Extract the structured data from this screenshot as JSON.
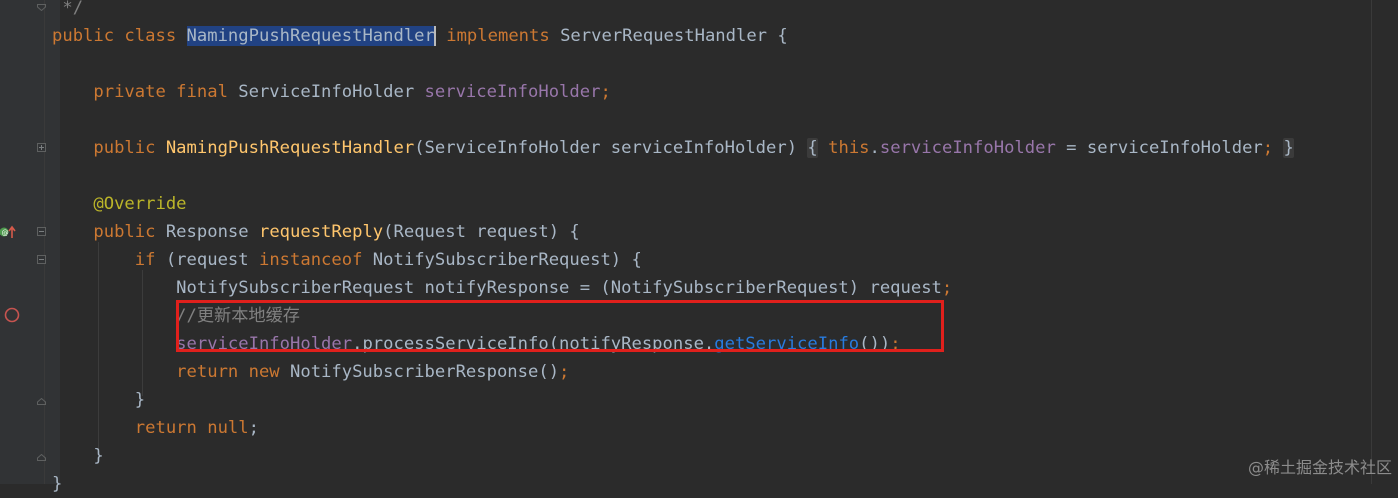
{
  "editor": {
    "lines": [
      {
        "id": "l0",
        "tokens": [
          {
            "c": "cmt",
            "t": " */"
          }
        ]
      },
      {
        "id": "l1",
        "tokens": [
          {
            "c": "kw",
            "t": "public class "
          },
          {
            "c": "sel",
            "t": "NamingPushRequestHandler"
          },
          {
            "c": "caret",
            "t": ""
          },
          {
            "c": "kw",
            "t": " implements "
          },
          {
            "c": "txt",
            "t": "ServerRequestHandler {"
          }
        ]
      },
      {
        "id": "l2",
        "tokens": []
      },
      {
        "id": "l3",
        "tokens": [
          {
            "c": "kw",
            "t": "    private final "
          },
          {
            "c": "txt",
            "t": "ServiceInfoHolder "
          },
          {
            "c": "fld",
            "t": "serviceInfoHolder"
          },
          {
            "c": "kw",
            "t": ";"
          }
        ]
      },
      {
        "id": "l4",
        "tokens": []
      },
      {
        "id": "l5",
        "tokens": [
          {
            "c": "kw",
            "t": "    public "
          },
          {
            "c": "mth",
            "t": "NamingPushRequestHandler"
          },
          {
            "c": "txt",
            "t": "(ServiceInfoHolder serviceInfoHolder) "
          },
          {
            "c": "brace-hl",
            "t": "{"
          },
          {
            "c": "txt",
            "t": " "
          },
          {
            "c": "kw",
            "t": "this"
          },
          {
            "c": "txt",
            "t": "."
          },
          {
            "c": "fld",
            "t": "serviceInfoHolder"
          },
          {
            "c": "txt",
            "t": " = serviceInfoHolder"
          },
          {
            "c": "kw",
            "t": "; "
          },
          {
            "c": "brace-hl",
            "t": "}"
          }
        ]
      },
      {
        "id": "l6",
        "tokens": []
      },
      {
        "id": "l7",
        "tokens": [
          {
            "c": "ann",
            "t": "    @Override"
          }
        ]
      },
      {
        "id": "l8",
        "tokens": [
          {
            "c": "kw",
            "t": "    public "
          },
          {
            "c": "txt",
            "t": "Response "
          },
          {
            "c": "mth",
            "t": "requestReply"
          },
          {
            "c": "txt",
            "t": "(Request request) {"
          }
        ]
      },
      {
        "id": "l9",
        "tokens": [
          {
            "c": "kw",
            "t": "        if "
          },
          {
            "c": "txt",
            "t": "(request "
          },
          {
            "c": "kw",
            "t": "instanceof "
          },
          {
            "c": "txt",
            "t": "NotifySubscriberRequest) {"
          }
        ]
      },
      {
        "id": "l10",
        "tokens": [
          {
            "c": "txt",
            "t": "            NotifySubscriberRequest notifyResponse = (NotifySubscriberRequest) request"
          },
          {
            "c": "kw",
            "t": ";"
          }
        ]
      },
      {
        "id": "l11",
        "tokens": [
          {
            "c": "cmt",
            "t": "            //更新本地缓存"
          }
        ]
      },
      {
        "id": "l12",
        "tokens": [
          {
            "c": "fld",
            "t": "            serviceInfoHolder"
          },
          {
            "c": "txt",
            "t": ".processServiceInfo(notifyResponse."
          },
          {
            "c": "call",
            "t": "getServiceInfo"
          },
          {
            "c": "txt",
            "t": "())"
          },
          {
            "c": "kw",
            "t": ";"
          }
        ]
      },
      {
        "id": "l13",
        "tokens": [
          {
            "c": "kw",
            "t": "            return new "
          },
          {
            "c": "txt",
            "t": "NotifySubscriberResponse()"
          },
          {
            "c": "kw",
            "t": ";"
          }
        ]
      },
      {
        "id": "l14",
        "tokens": [
          {
            "c": "txt",
            "t": "        }"
          }
        ]
      },
      {
        "id": "l15",
        "tokens": [
          {
            "c": "kw",
            "t": "        return null"
          },
          {
            "c": "txt",
            "t": ";"
          }
        ]
      },
      {
        "id": "l16",
        "tokens": [
          {
            "c": "txt",
            "t": "    }"
          }
        ]
      },
      {
        "id": "l17",
        "tokens": [
          {
            "c": "txt",
            "t": "}"
          }
        ]
      }
    ]
  },
  "watermark": "@稀土掘金技术社区",
  "colors": {
    "background": "#2b2b2b",
    "keyword": "#cc7832",
    "field": "#9876aa",
    "method_decl": "#ffc66d",
    "annotation": "#bbb529",
    "comment": "#808080",
    "highlight_box": "#e0201c"
  }
}
